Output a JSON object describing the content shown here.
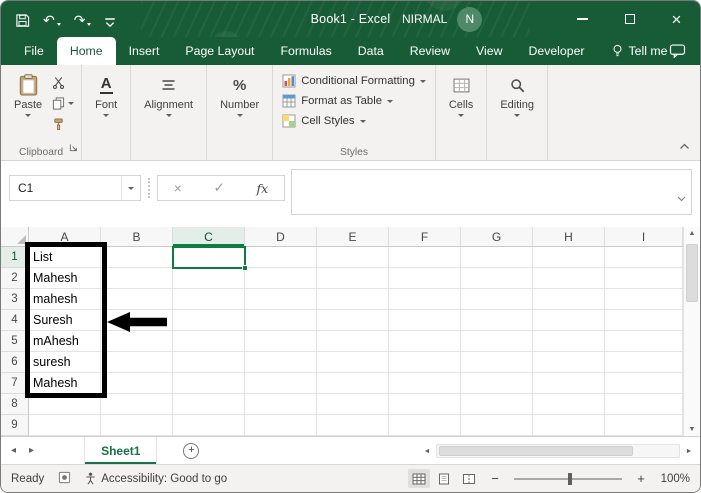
{
  "titlebar": {
    "title": "Book1  -  Excel",
    "user_name": "NIRMAL",
    "avatar_letter": "N"
  },
  "tabs": {
    "items": [
      {
        "label": "File"
      },
      {
        "label": "Home"
      },
      {
        "label": "Insert"
      },
      {
        "label": "Page Layout"
      },
      {
        "label": "Formulas"
      },
      {
        "label": "Data"
      },
      {
        "label": "Review"
      },
      {
        "label": "View"
      },
      {
        "label": "Developer"
      }
    ],
    "active_tab": "Home",
    "tell_me": "Tell me"
  },
  "ribbon": {
    "paste_label": "Paste",
    "font_label": "Font",
    "alignment_label": "Alignment",
    "number_label": "Number",
    "styles_buttons": [
      "Conditional Formatting",
      "Format as Table",
      "Cell Styles"
    ],
    "cells_label": "Cells",
    "editing_label": "Editing",
    "group_clipboard": "Clipboard",
    "group_styles": "Styles"
  },
  "formula_bar": {
    "name_box": "C1",
    "fx_label": "fx"
  },
  "sheet": {
    "columns": [
      "A",
      "B",
      "C",
      "D",
      "E",
      "F",
      "G",
      "H",
      "I"
    ],
    "rows": [
      "1",
      "2",
      "3",
      "4",
      "5",
      "6",
      "7",
      "8",
      "9"
    ],
    "column_a_values": [
      "List",
      "Mahesh",
      "mahesh",
      "Suresh",
      "mAhesh",
      "suresh",
      "Mahesh"
    ],
    "selected_cell": "C1",
    "selected_column": "C",
    "selected_row": "1"
  },
  "sheet_tabs": {
    "active": "Sheet1"
  },
  "status_bar": {
    "mode": "Ready",
    "accessibility": "Accessibility: Good to go",
    "zoom_level": "100%"
  },
  "icons": {
    "undo": "↶",
    "redo": "↷",
    "close": "×",
    "cancel": "×",
    "check": "✓",
    "percent": "%",
    "font_letter": "A",
    "zoom_out": "−",
    "zoom_in": "+",
    "add_sheet": "+",
    "nav_left": "◂",
    "nav_right": "▸",
    "scroll_left": "◄",
    "scroll_right": "►",
    "scroll_up": "▲",
    "scroll_down": "▼"
  },
  "colors": {
    "excel_green": "#185C37",
    "accent_green": "#107C41"
  }
}
